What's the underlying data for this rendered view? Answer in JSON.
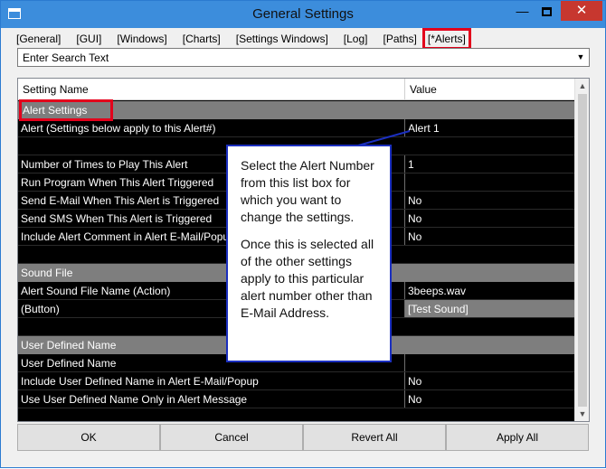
{
  "window": {
    "title": "General Settings"
  },
  "titlebar_buttons": {
    "minimize": "—",
    "close": "✕"
  },
  "tabs": [
    {
      "label": "[General]",
      "active": false
    },
    {
      "label": "[GUI]",
      "active": false
    },
    {
      "label": "[Windows]",
      "active": false
    },
    {
      "label": "[Charts]",
      "active": false
    },
    {
      "label": "[Settings Windows]",
      "active": false
    },
    {
      "label": "[Log]",
      "active": false
    },
    {
      "label": "[Paths]",
      "active": false
    },
    {
      "label": "[*Alerts]",
      "active": true
    }
  ],
  "search": {
    "value": "Enter Search Text",
    "dropdown_glyph": "▼"
  },
  "grid": {
    "headers": {
      "name": "Setting Name",
      "value": "Value"
    },
    "rows": [
      {
        "name": "Alert Settings",
        "value": "",
        "section": true
      },
      {
        "name": "Alert (Settings below apply to this Alert#)",
        "value": "Alert 1"
      },
      {
        "name": "",
        "value": ""
      },
      {
        "name": "Number of Times to Play This Alert",
        "value": "1"
      },
      {
        "name": "Run Program When This Alert Triggered",
        "value": ""
      },
      {
        "name": "Send E-Mail When This Alert is Triggered",
        "value": "No"
      },
      {
        "name": "Send SMS When This Alert is Triggered",
        "value": "No"
      },
      {
        "name": "Include Alert Comment in Alert E-Mail/Popup",
        "value": "No"
      },
      {
        "name": "",
        "value": ""
      },
      {
        "name": "Sound File",
        "value": "",
        "section": true
      },
      {
        "name": "Alert Sound File Name (Action)",
        "value": "3beeps.wav"
      },
      {
        "name": " (Button)",
        "value": "[Test Sound]",
        "gray_value": true
      },
      {
        "name": "",
        "value": ""
      },
      {
        "name": "User Defined Name",
        "value": "",
        "section": true
      },
      {
        "name": "User Defined Name",
        "value": ""
      },
      {
        "name": "Include User Defined Name in Alert E-Mail/Popup",
        "value": "No"
      },
      {
        "name": "Use User Defined Name Only in Alert Message",
        "value": "No"
      },
      {
        "name": "",
        "value": ""
      }
    ],
    "scroll_up": "▲",
    "scroll_down": "▼"
  },
  "callout": {
    "paragraph1": "Select the Alert Number from this list box for which you want to change the settings.",
    "paragraph2": "Once this is selected all of the other settings apply to this particular alert number other than E-Mail Address."
  },
  "buttons": {
    "ok": "OK",
    "cancel": "Cancel",
    "revert_all": "Revert All",
    "apply_all": "Apply All"
  },
  "colors": {
    "titlebar": "#3c8ddc",
    "close_button": "#c7372f",
    "highlight": "#e3001b",
    "callout_border": "#1b2fbf",
    "grid_bg": "#000000",
    "section_bg": "#7e7e7e"
  }
}
